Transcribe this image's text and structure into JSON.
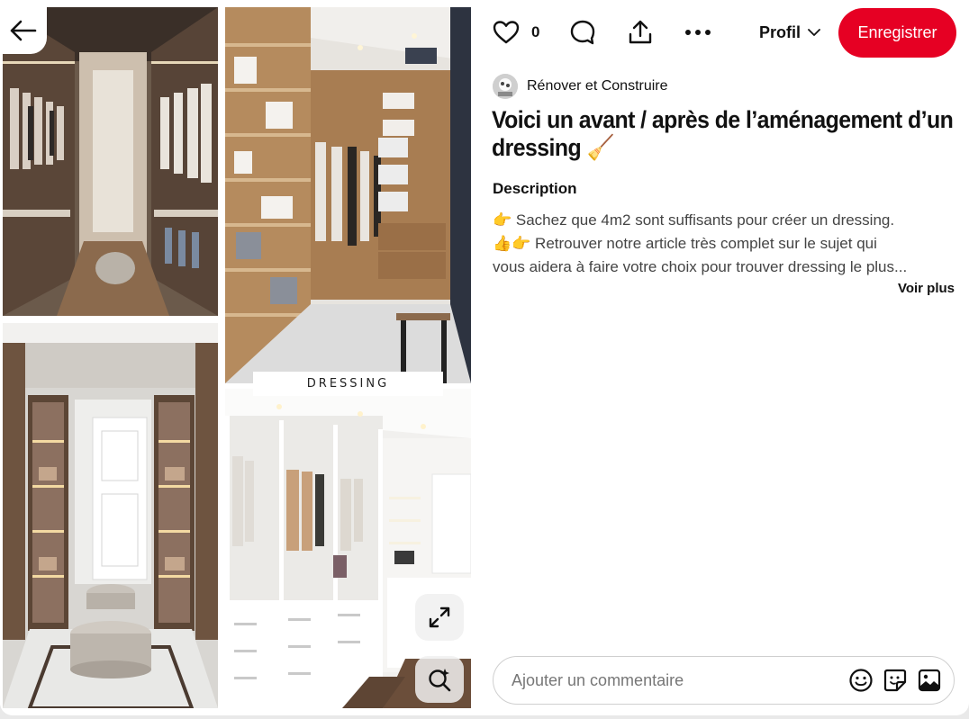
{
  "pin": {
    "image_label": "DRESSING",
    "like_count": "0",
    "profile_label": "Profil",
    "save_label": "Enregistrer",
    "creator_name": "Rénover et Construire",
    "title": "Voici un avant / après de l’aménagement d’un dressing 🧹",
    "description_heading": "Description",
    "description_lines": [
      "👉 Sachez que 4m2 sont suffisants pour créer un dressing.",
      "👍👉 Retrouver notre article très complet sur le sujet qui",
      "vous aidera à faire votre choix pour trouver dressing le plus..."
    ],
    "see_more_label": "Voir plus"
  },
  "comment": {
    "placeholder": "Ajouter un commentaire"
  },
  "colors": {
    "accent": "#e60023",
    "text": "#111111",
    "muted": "#444444"
  },
  "icons": [
    "back-arrow-icon",
    "heart-icon",
    "comment-bubble-icon",
    "share-icon",
    "more-icon",
    "chevron-down-icon",
    "expand-icon",
    "visual-search-icon",
    "emoji-icon",
    "sticker-icon",
    "image-icon"
  ]
}
